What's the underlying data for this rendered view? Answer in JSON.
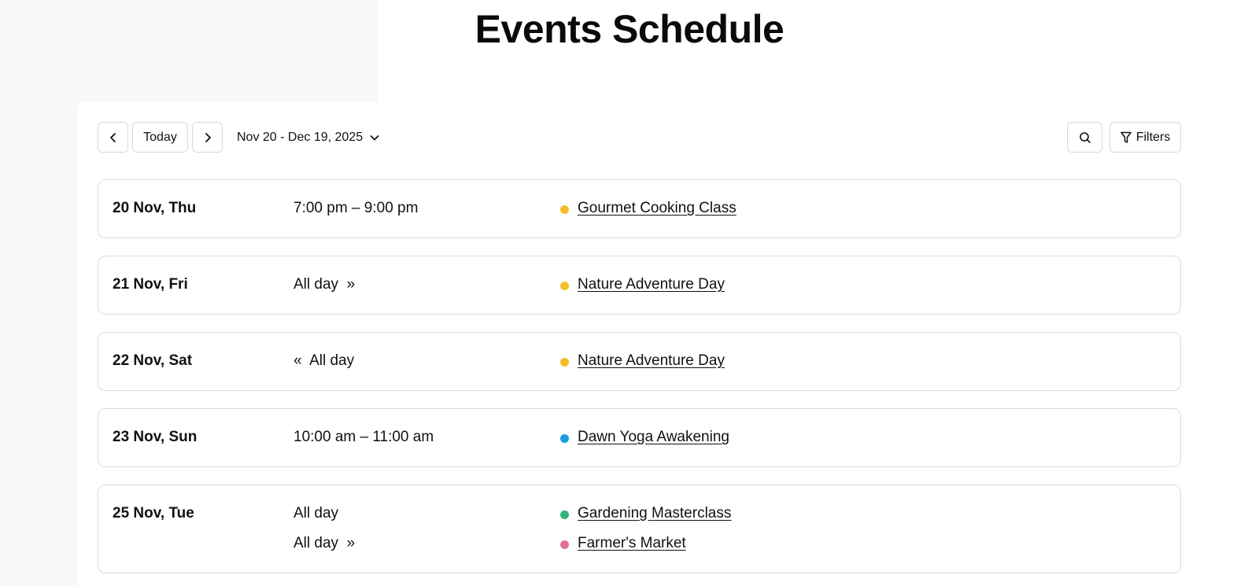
{
  "page": {
    "title": "Events Schedule"
  },
  "toolbar": {
    "prev_icon": "chevron-left-icon",
    "today_label": "Today",
    "next_icon": "chevron-right-icon",
    "range_label": "Nov 20 - Dec 19, 2025",
    "range_icon": "chevron-down-icon",
    "search_icon": "search-icon",
    "filters_label": "Filters",
    "filters_icon": "filter-icon"
  },
  "colors": {
    "yellow": "#f4bd2a",
    "blue": "#1a9be0",
    "green": "#2fb37a",
    "pink": "#e0729a"
  },
  "days": [
    {
      "date": "20 Nov, Thu",
      "events": [
        {
          "time": "7:00 pm – 9:00 pm",
          "title": "Gourmet Cooking Class",
          "color": "#f4bd2a"
        }
      ]
    },
    {
      "date": "21 Nov, Fri",
      "events": [
        {
          "time": "All day  »",
          "title": "Nature Adventure Day",
          "color": "#f4bd2a"
        }
      ]
    },
    {
      "date": "22 Nov, Sat",
      "events": [
        {
          "time": "«  All day",
          "title": "Nature Adventure Day",
          "color": "#f4bd2a"
        }
      ]
    },
    {
      "date": "23 Nov, Sun",
      "events": [
        {
          "time": "10:00 am – 11:00 am",
          "title": "Dawn Yoga Awakening",
          "color": "#1a9be0"
        }
      ]
    },
    {
      "date": "25 Nov, Tue",
      "events": [
        {
          "time": "All day",
          "title": "Gardening Masterclass",
          "color": "#2fb37a"
        },
        {
          "time": "All day  »",
          "title": "Farmer's Market",
          "color": "#e0729a"
        }
      ]
    }
  ]
}
